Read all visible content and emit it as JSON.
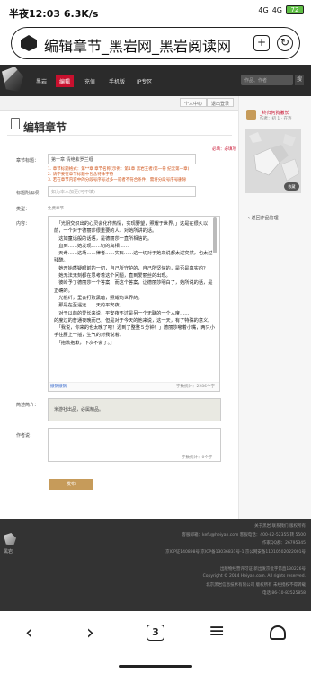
{
  "status_bar": {
    "time": "半夜12:03",
    "speed": "6.3K/s",
    "signal1": "4G",
    "signal2": "4G",
    "battery": "72"
  },
  "browser": {
    "page_title": "编辑章节_黑岩网_黑岩阅读网",
    "tab_count": "3"
  },
  "site": {
    "logo_text": "黑岩",
    "nav": [
      "黑岩",
      "编辑",
      "充值",
      "手机版",
      "IP专区"
    ],
    "search_placeholder": "作品、作者",
    "search_button": "搜",
    "subtabs": [
      "个人中心",
      "退出登录"
    ]
  },
  "form": {
    "page_title": "编辑章节",
    "required_note": "必填：必填项",
    "chapter_title_label": "章节标题：",
    "chapter_title_value": "第一章 情绝紫罗兰缠",
    "chapter_title_hints": [
      "1. 章节标题格式：第**章 章节名称(示例：第1章 黑岩王者/第一卷 纪元第一章)",
      "2. 请不要在章节标题中包含特殊字符",
      "3. 若在章节内容中的分段号序号过多一或者不符合条件，需将分段号序号删除"
    ],
    "subtitle_label": "标题附加项：",
    "subtitle_placeholder": "如为本人加更(可不填)",
    "type_label": "类型：",
    "type_value": "免费章节",
    "content_label": "内容：",
    "content_text": "　「光阴交织出的心灵会化作热情，实现野望，照耀于世界。」这是在很久以前，一个对于德丽莎很重要的人，对她所讲的话。\n　这如童话般的话语，是德丽莎一直所相信的。\n　直到……她发现……切的真相……\n　天命……这场……律者……实石……这一切对于她来说都太过突然，也太过残酷。\n　她开始质疑眼前的一切，自己所守护的，自己所坚信的，是否是真实的？\n　她无法无刻都在思考着这个问题，直到爱丽丝的出现。\n　彼岭予了德丽莎一个答案，而这个答案，让德丽莎明白了，她所说的话，是正确的。\n　光棍纤，里会打败黑暗，照耀向世界的。\n　那是在至遥远……天的平安夜。\n　对于以前的爱长来说，平安夜不过是另一个无聊的一个人度……\n的度过的普通夜晚而已，但是对于今天的他来说，这一天，有了特殊的意义。\n　「我说，你来的也太晚了吧！迟到了整整５分钟！」德丽莎嘟着小嘴，两只小手往腰上一插，生气的对我说着。\n　「抱歉抱歉，下次不会了。」",
    "word_count": "字数统计：2286个字",
    "reset_link": "撤销撤销",
    "intro_label": "简述简介：",
    "intro_value": "米游社出品，必属精品。",
    "say_label": "作者说：",
    "say_count": "字数统计：0个字",
    "publish_button": "发布"
  },
  "sidebar": {
    "book_name": "_终归何狗撇长",
    "book_meta": "作者：初 1 · 在连",
    "cover_badge": "收藏",
    "back_link": "返回作品管理"
  },
  "footer": {
    "links": "关于黑岩  联系我们  版权所有",
    "contact": "客服邮箱：kefu@heiyan.com  客服电话：400-82-52355  转 5500",
    "qq": "作家QQ群：26795345",
    "icp": "京ICP证140898号  京ICP备13036831号-1  京公网安备11010502022001号",
    "culture": "出版物经营许可证 新出发京批字第直130226号",
    "copyright": "Copyright © 2014 Heiyan.com. All rights reserved.",
    "company": "北京黑岩信息技术有限公司 版权所有 未经授权不得转载",
    "phone": "电话 86-10-82525858"
  }
}
